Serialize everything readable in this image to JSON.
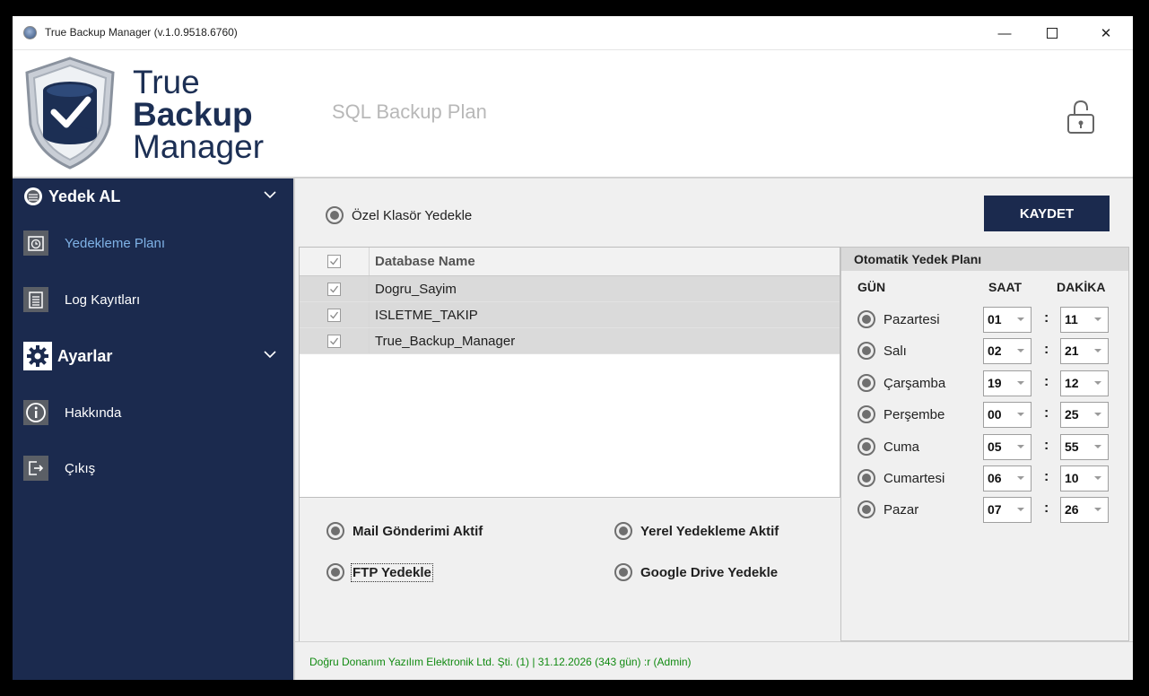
{
  "window": {
    "title": "True Backup Manager (v.1.0.9518.6760)",
    "minimize": "—",
    "close": "✕"
  },
  "header": {
    "logo_line1": "True",
    "logo_line2": "Backup",
    "logo_line3": "Manager",
    "page_title": "SQL Backup Plan"
  },
  "sidebar": {
    "section_backup": "Yedek AL",
    "items_backup": [
      {
        "label": "Yedekleme Planı",
        "active": true
      },
      {
        "label": "Log Kayıtları",
        "active": false
      }
    ],
    "section_settings": "Ayarlar",
    "items_settings": [
      {
        "label": "Hakkında"
      },
      {
        "label": "Çıkış"
      }
    ]
  },
  "content": {
    "custom_folder_option": "Özel Klasör Yedekle",
    "save_button": "KAYDET",
    "grid": {
      "column_name": "Database Name",
      "rows": [
        "Dogru_Sayim",
        "ISLETME_TAKIP",
        "True_Backup_Manager"
      ]
    },
    "options": {
      "mail": "Mail Gönderimi Aktif",
      "local": "Yerel Yedekleme Aktif",
      "ftp": "FTP Yedekle",
      "gdrive": "Google Drive Yedekle"
    },
    "plan": {
      "title": "Otomatik Yedek Planı",
      "col_day": "GÜN",
      "col_hour": "SAAT",
      "col_minute": "DAKİKA",
      "separator": ":",
      "days": [
        {
          "day": "Pazartesi",
          "hour": "01",
          "minute": "11"
        },
        {
          "day": "Salı",
          "hour": "02",
          "minute": "21"
        },
        {
          "day": "Çarşamba",
          "hour": "19",
          "minute": "12"
        },
        {
          "day": "Perşembe",
          "hour": "00",
          "minute": "25"
        },
        {
          "day": "Cuma",
          "hour": "05",
          "minute": "55"
        },
        {
          "day": "Cumartesi",
          "hour": "06",
          "minute": "10"
        },
        {
          "day": "Pazar",
          "hour": "07",
          "minute": "26"
        }
      ]
    }
  },
  "status": {
    "text": "Doğru Donanım Yazılım Elektronik Ltd. Şti. (1)  |  31.12.2026  (343 gün) :r  (Admin)"
  },
  "colors": {
    "sidebar_bg": "#1b2a4e",
    "active_item": "#7fb2e6",
    "status_green": "#118a11"
  }
}
